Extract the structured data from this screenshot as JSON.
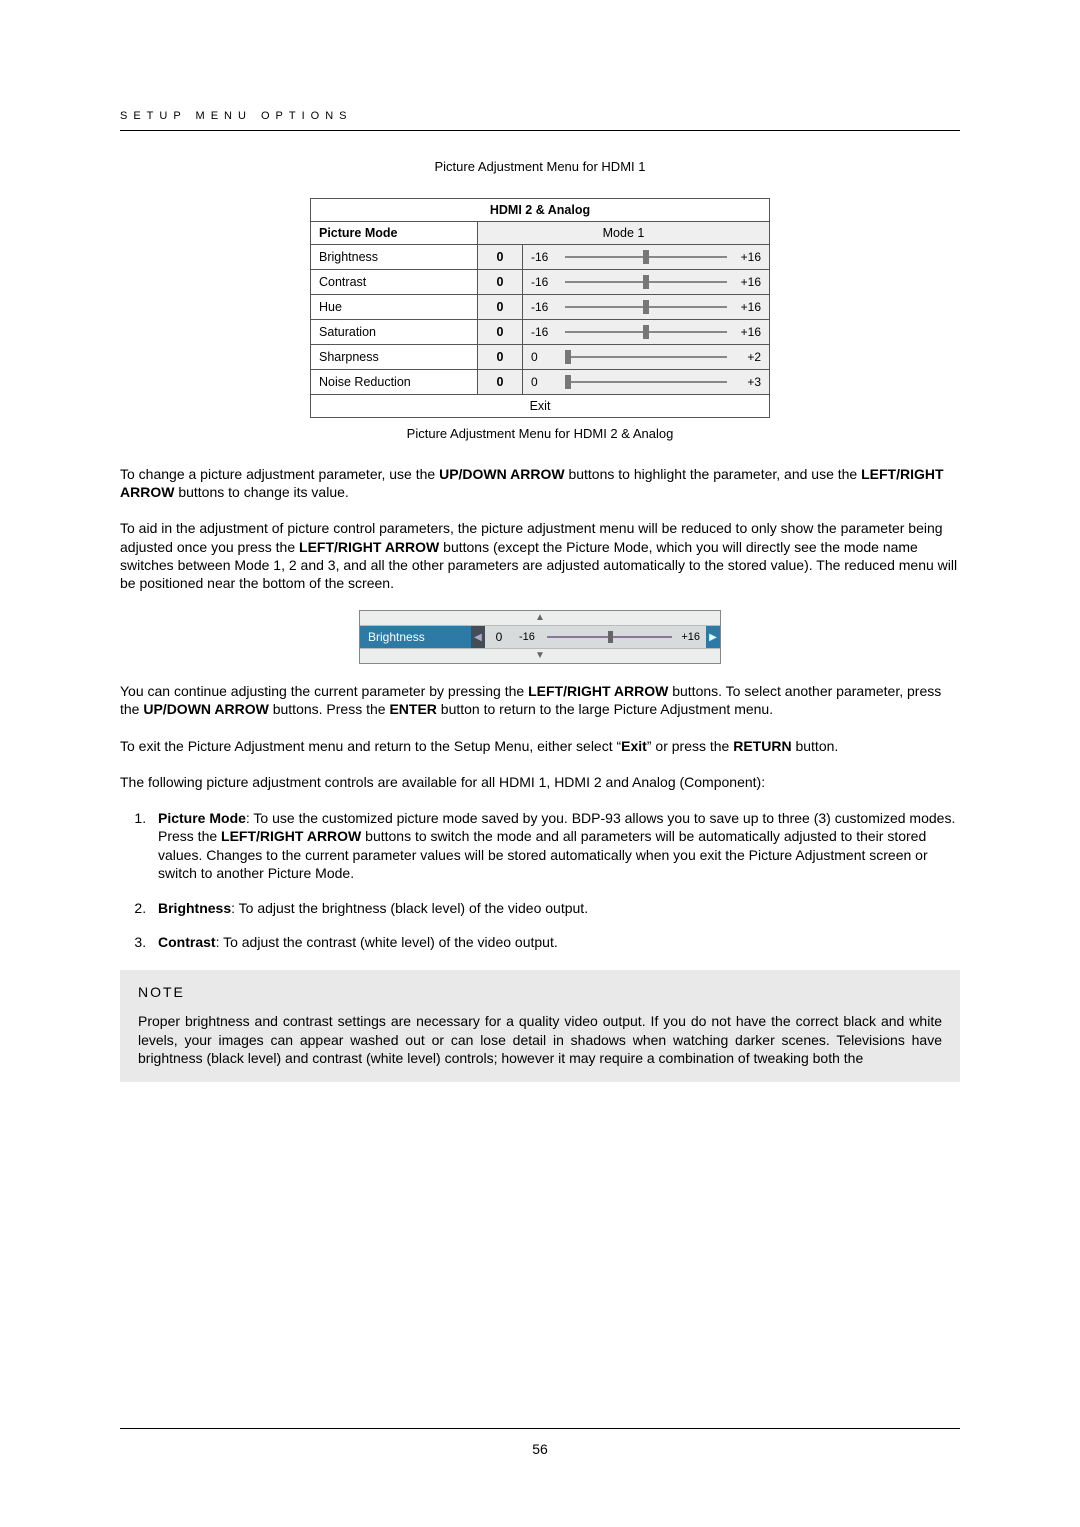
{
  "header": {
    "section_title": "SETUP MENU OPTIONS"
  },
  "captions": {
    "top": "Picture Adjustment Menu for HDMI 1",
    "mid": "Picture Adjustment Menu for HDMI 2 & Analog"
  },
  "menu": {
    "title": "HDMI 2 & Analog",
    "mode_label": "Picture Mode",
    "mode_value": "Mode 1",
    "exit_label": "Exit",
    "rows": [
      {
        "label": "Brightness",
        "value": "0",
        "min": "-16",
        "max": "+16",
        "pos": 50
      },
      {
        "label": "Contrast",
        "value": "0",
        "min": "-16",
        "max": "+16",
        "pos": 50
      },
      {
        "label": "Hue",
        "value": "0",
        "min": "-16",
        "max": "+16",
        "pos": 50
      },
      {
        "label": "Saturation",
        "value": "0",
        "min": "-16",
        "max": "+16",
        "pos": 50
      },
      {
        "label": "Sharpness",
        "value": "0",
        "min": "0",
        "max": "+2",
        "pos": 2
      },
      {
        "label": "Noise Reduction",
        "value": "0",
        "min": "0",
        "max": "+3",
        "pos": 2
      }
    ]
  },
  "paragraphs": {
    "p1a": "To change a picture adjustment parameter, use the ",
    "p1b": " buttons to highlight the parameter, and use the ",
    "p1c": " buttons to change its value.",
    "p2a": "To aid in the adjustment of picture control parameters, the picture adjustment menu will be reduced to only show the parameter being adjusted once you press the ",
    "p2b": " buttons (except the Picture Mode, which you will directly see the mode name switches between Mode 1, 2 and 3, and all the other parameters are adjusted automatically to the stored value).  The reduced menu will be positioned near the bottom of the screen.",
    "p3a": "You can continue adjusting the current parameter by pressing the ",
    "p3b": " buttons.  To select another parameter, press the ",
    "p3c": " buttons.  Press the ",
    "p3d": " button to return to the large Picture Adjustment menu.",
    "p4a": "To exit the Picture Adjustment menu and return to the Setup Menu, either select “",
    "p4b": "” or press the ",
    "p4c": " button.",
    "p5": "The following picture adjustment controls are available for all HDMI 1, HDMI 2 and Analog (Component):"
  },
  "bold": {
    "updown": "UP/DOWN ARROW",
    "leftright": "LEFT/RIGHT ARROW",
    "enter": "ENTER",
    "exit": "Exit",
    "return": "RETURN",
    "picture_mode": "Picture Mode",
    "brightness": "Brightness",
    "contrast": "Contrast"
  },
  "list_items": {
    "i1_prefix": "",
    "i1_rest": ": To use the customized picture mode saved by you. BDP-93 allows you to save up to three (3) customized modes. Press the ",
    "i1_rest2": " buttons to switch the mode and all parameters will be automatically adjusted to their stored values.  Changes to the current parameter values will be stored automatically when you exit the Picture Adjustment screen or switch to another Picture Mode.",
    "i2_rest": ": To adjust the brightness (black level) of the video output.",
    "i3_rest": ": To adjust the contrast (white level) of the video output."
  },
  "mini": {
    "label": "Brightness",
    "value": "0",
    "min": "-16",
    "max": "+16"
  },
  "note": {
    "title": "NOTE",
    "body": "Proper brightness and contrast settings are necessary for a quality video output. If you do not have the correct black and white levels, your images can appear washed out or can lose detail in shadows when watching darker scenes. Televisions have brightness (black level) and contrast (white level) controls; however it may require a combination of tweaking both the"
  },
  "footer": {
    "page": "56"
  }
}
